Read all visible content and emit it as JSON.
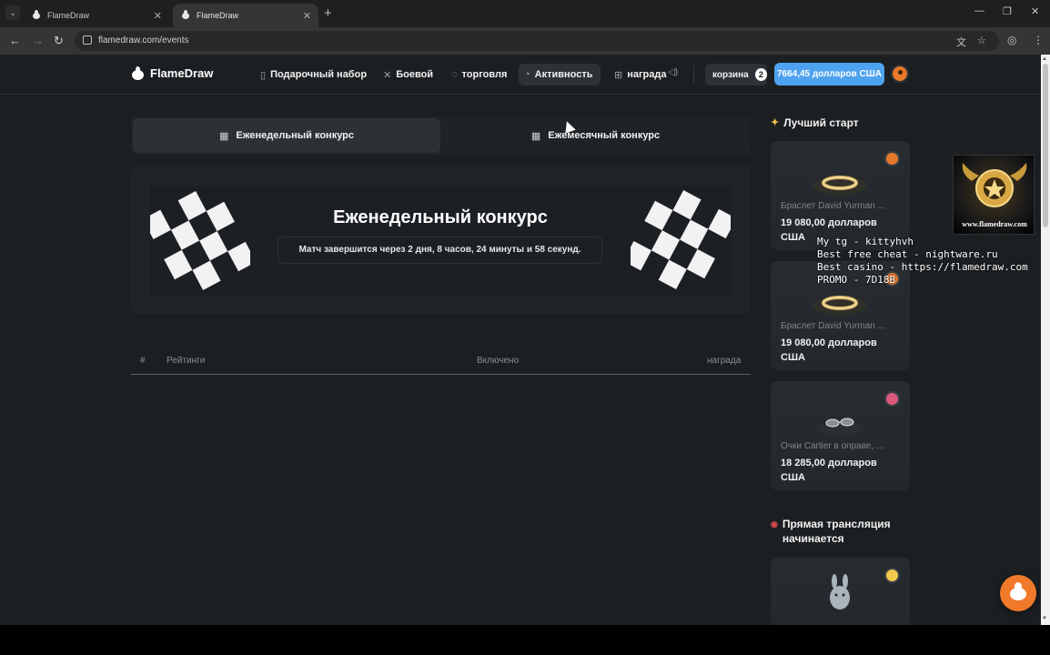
{
  "browser": {
    "tabs": [
      {
        "title": "FlameDraw"
      },
      {
        "title": "FlameDraw"
      }
    ],
    "url": "flamedraw.com/events"
  },
  "header": {
    "logo": "FlameDraw",
    "nav": [
      {
        "label": "Подарочный набор",
        "icon": "gift-box-icon"
      },
      {
        "label": "Боевой",
        "icon": "crossed-swords-icon"
      },
      {
        "label": "торговля",
        "icon": "refresh-icon"
      },
      {
        "label": "Активность",
        "icon": "activity-icon"
      },
      {
        "label": "награда",
        "icon": "gift-icon"
      }
    ],
    "cart_label": "корзина",
    "cart_count": "2",
    "balance": "7664,45 долларов США"
  },
  "contest": {
    "tabs": [
      {
        "label": "Еженедельный конкурс",
        "icon": "calendar-icon"
      },
      {
        "label": "Ежемесячный конкурс",
        "icon": "calendar-icon"
      }
    ],
    "active_tab": 0,
    "title": "Еженедельный конкурс",
    "countdown": "Матч завершится через 2 дня, 8 часов, 24 минуты и 58 секунд.",
    "table_headers": {
      "rank": "#",
      "ratings": "Рейтинги",
      "included": "Включено",
      "reward": "награда"
    }
  },
  "sidebar": {
    "best_start_title": "Лучший старт",
    "best_start_items": [
      {
        "name": "Браслет David Yurman ...",
        "price": "19 080,00 долларов США",
        "accent": "#e8782a"
      },
      {
        "name": "Браслет David Yurman ...",
        "price": "19 080,00 долларов США",
        "accent": "#e8782a"
      },
      {
        "name": "Очки Cartier в оправе, ...",
        "price": "18 285,00 долларов США",
        "accent": "#d95a7a"
      }
    ],
    "live_title": "Прямая трансляция начинается",
    "live_items": [
      {
        "accent": "#f2c94c"
      }
    ]
  },
  "overlay": {
    "promo_site": "www.flamedraw.com",
    "lines": "My tg - kittyhvh\nBest free cheat - nightware.ru\nBest casino - https://flamedraw.com\nPROMO - 7D18B"
  },
  "colors": {
    "balance": "#4ea3f0",
    "accent": "#f07a2a",
    "background": "#1c1f22"
  }
}
